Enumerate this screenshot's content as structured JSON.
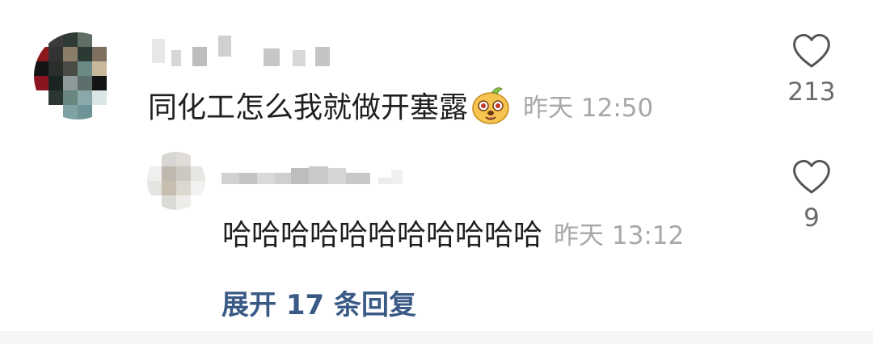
{
  "comment": {
    "username_hidden": true,
    "text": "同化工怎么我就做开塞露",
    "emoji": "dog-face-emoji",
    "time": "昨天 12:50",
    "likes": "213"
  },
  "reply": {
    "username_hidden": true,
    "text": "哈哈哈哈哈哈哈哈哈哈哈",
    "time": "昨天 13:12",
    "likes": "9"
  },
  "expand_label": "展开 17 条回复",
  "icons": {
    "like": "heart-outline-icon"
  },
  "colors": {
    "text": "#1f1f1f",
    "meta": "#a8a8a8",
    "like_count": "#6b6b6b",
    "link": "#3a5a86"
  }
}
